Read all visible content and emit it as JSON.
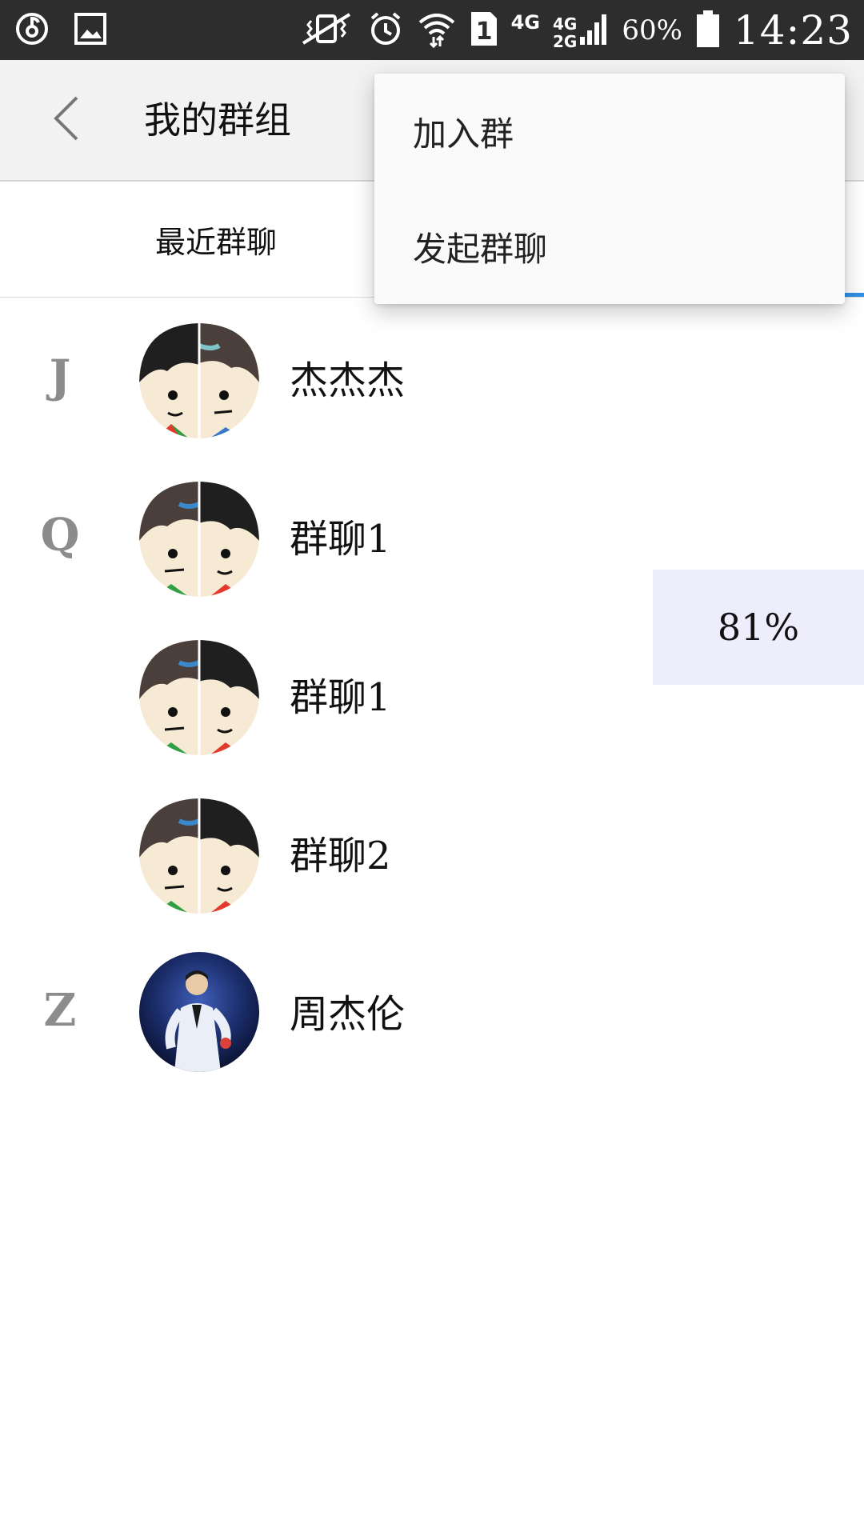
{
  "status_bar": {
    "network_primary": "4G",
    "network_secondary_top": "4G",
    "network_secondary_bottom": "2G",
    "sim_slot": "1",
    "battery_percent": "60%",
    "time": "14:23",
    "icons": [
      "netease-music-icon",
      "gallery-icon",
      "vibrate-icon",
      "alarm-icon",
      "wifi-icon",
      "sim-icon",
      "signal-icon",
      "battery-icon"
    ]
  },
  "header": {
    "title": "我的群组",
    "back_icon": "chevron-left-icon"
  },
  "tabs": {
    "recent_label": "最近群聊",
    "active_indicator_color": "#2f8fe6"
  },
  "groups": [
    {
      "index": "J",
      "name": "杰杰杰",
      "avatar": "cartoon-couple-dark-left"
    },
    {
      "index": "Q",
      "name": "群聊1",
      "avatar": "cartoon-couple-light-left"
    },
    {
      "index": "",
      "name": "群聊1",
      "avatar": "cartoon-couple-light-left"
    },
    {
      "index": "",
      "name": "群聊2",
      "avatar": "cartoon-couple-light-left"
    },
    {
      "index": "Z",
      "name": "周杰伦",
      "avatar": "singer-photo"
    }
  ],
  "overlay": {
    "percent": "81%"
  },
  "menu": {
    "items": [
      {
        "label": "加入群"
      },
      {
        "label": "发起群聊"
      }
    ]
  },
  "colors": {
    "status_bar_bg": "#2d2d2d",
    "app_bar_bg": "#f2f2f2",
    "index_letter": "#8c8c8c",
    "overlay_bg": "#ededfb",
    "menu_bg": "#fafafa"
  }
}
